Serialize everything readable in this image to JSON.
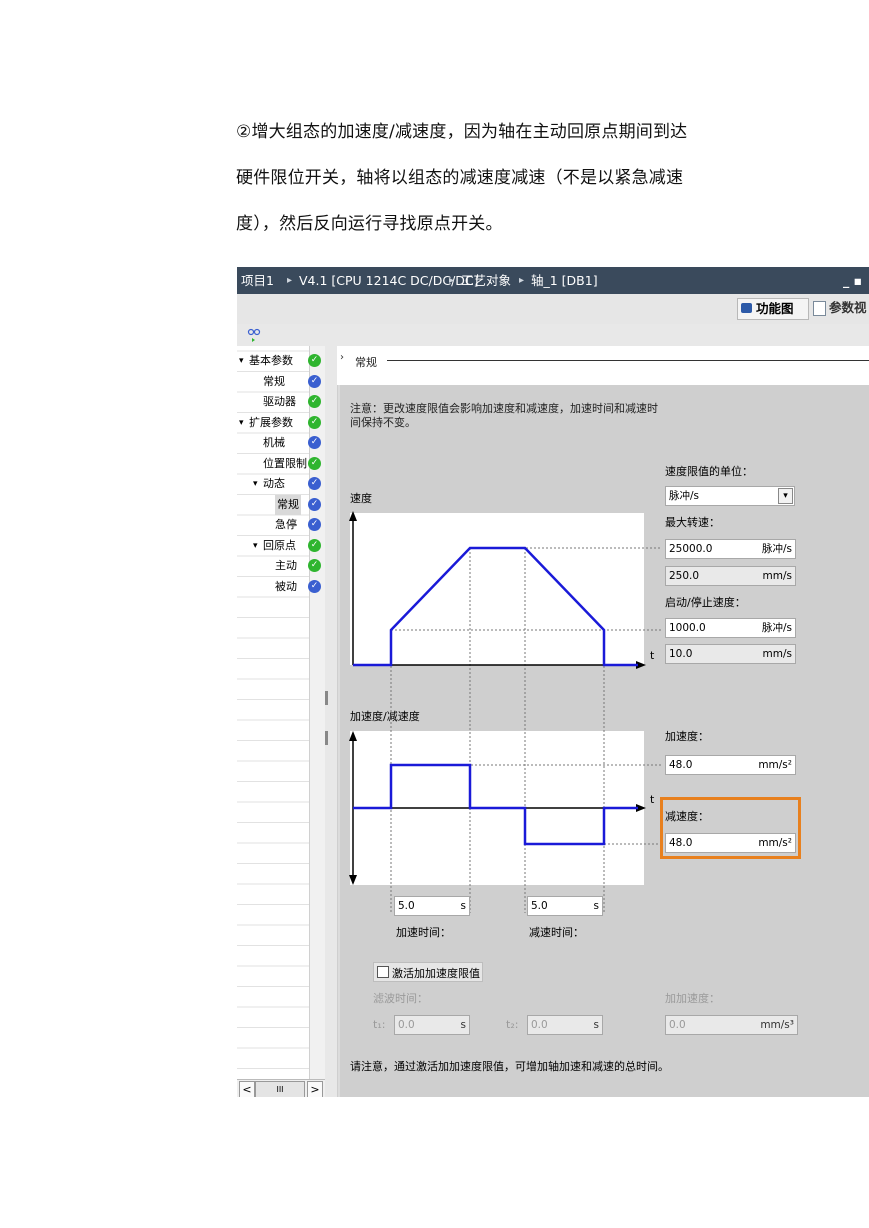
{
  "paragraph": {
    "line1": "②增大组态的加速度/减速度，因为轴在主动回原点期间到达",
    "line2": "硬件限位开关，轴将以组态的减速度减速（不是以紧急减速",
    "line3": "度），然后反向运行寻找原点开关。"
  },
  "titlebar": {
    "crumbs": [
      "项目1",
      "V4.1 [CPU 1214C DC/DC/DC]",
      "工艺对象",
      "轴_1 [DB1]"
    ],
    "window_controls": "_ ▪"
  },
  "toolbar": {
    "function_view": "功能图",
    "param_view": "参数视"
  },
  "nav": {
    "items": [
      {
        "label": "基本参数",
        "level": 0,
        "expander": "▾",
        "check": "green"
      },
      {
        "label": "常规",
        "level": 1,
        "check": "blue"
      },
      {
        "label": "驱动器",
        "level": 1,
        "check": "green"
      },
      {
        "label": "扩展参数",
        "level": 0,
        "expander": "▾",
        "check": "green"
      },
      {
        "label": "机械",
        "level": 1,
        "check": "blue"
      },
      {
        "label": "位置限制",
        "level": 1,
        "check": "green"
      },
      {
        "label": "动态",
        "level": 1,
        "expander": "▾",
        "check": "blue"
      },
      {
        "label": "常规",
        "level": 2,
        "check": "blue",
        "selected": true
      },
      {
        "label": "急停",
        "level": 2,
        "check": "blue"
      },
      {
        "label": "回原点",
        "level": 1,
        "expander": "▾",
        "check": "green"
      },
      {
        "label": "主动",
        "level": 2,
        "check": "green"
      },
      {
        "label": "被动",
        "level": 2,
        "check": "blue"
      }
    ],
    "scroll_left": "<",
    "scroll_thumb": "III",
    "scroll_right": ">"
  },
  "section": {
    "title": "常规"
  },
  "note": {
    "line1": "注意：更改速度限值会影响加速度和减速度，加速时间和减速时",
    "line2": "间保持不变。"
  },
  "velocity_chart": {
    "title": "速度",
    "t_label": "t"
  },
  "accel_chart": {
    "title": "加速度/减速度",
    "t_label": "t"
  },
  "speed_limit_unit": {
    "label": "速度限值的单位：",
    "value": "脉冲/s",
    "dropdown_arrow": "▾"
  },
  "max_speed": {
    "label": "最大转速：",
    "value": "25000.0",
    "unit": "脉冲/s",
    "value2": "250.0",
    "unit2": "mm/s"
  },
  "start_stop_speed": {
    "label": "启动/停止速度：",
    "value": "1000.0",
    "unit": "脉冲/s",
    "value2": "10.0",
    "unit2": "mm/s"
  },
  "acceleration": {
    "label": "加速度：",
    "value": "48.0",
    "unit": "mm/s²"
  },
  "deceleration": {
    "label": "减速度：",
    "value": "48.0",
    "unit": "mm/s²"
  },
  "accel_time": {
    "value": "5.0",
    "unit": "s",
    "label": "加速时间："
  },
  "decel_time": {
    "value": "5.0",
    "unit": "s",
    "label": "减速时间："
  },
  "jerk": {
    "checkbox_label": "激活加加速度限值",
    "filter_time_label": "滤波时间：",
    "t1_label": "t₁:",
    "t1_value": "0.0",
    "t1_unit": "s",
    "t2_label": "t₂:",
    "t2_value": "0.0",
    "t2_unit": "s",
    "jerk_label": "加加速度：",
    "jerk_value": "0.0",
    "jerk_unit": "mm/s³"
  },
  "footer_note": "请注意，通过激活加加速度限值，可增加轴加速和减速的总时间。",
  "colors": {
    "titlebar": "#3a4a5c",
    "curve": "#1a1ad8",
    "highlight": "#e8801e",
    "check_green": "#2fb52f",
    "check_blue": "#3a5fd0"
  }
}
